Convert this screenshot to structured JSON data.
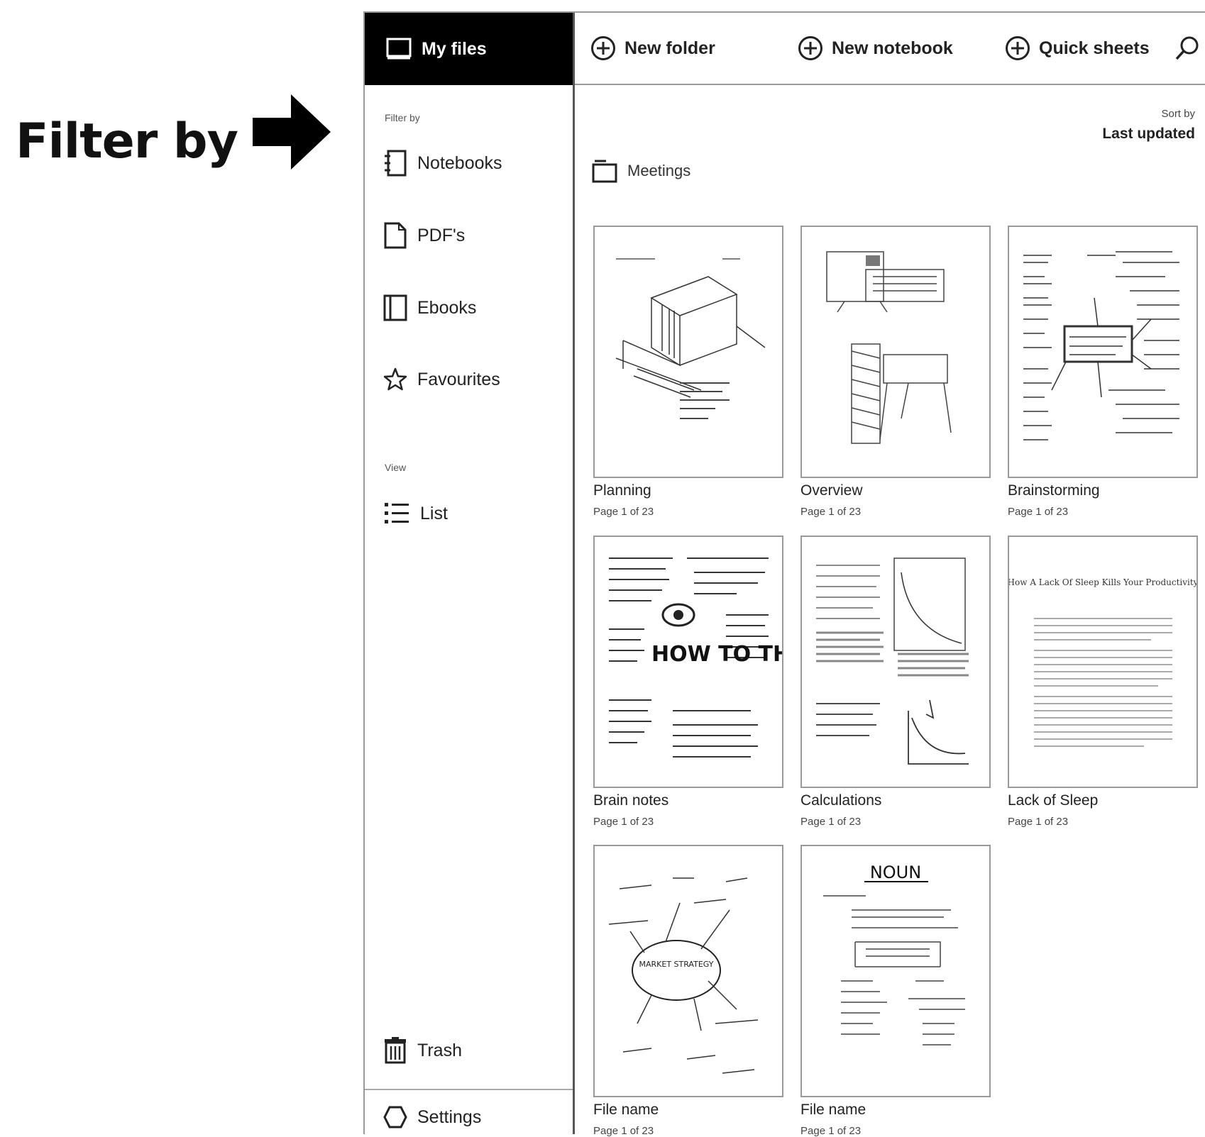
{
  "callout": {
    "text": "Filter by"
  },
  "sidebar": {
    "header_label": "My files",
    "filter_label": "Filter by",
    "filters": [
      {
        "label": "Notebooks",
        "icon": "notebook-icon"
      },
      {
        "label": "PDF's",
        "icon": "pdf-icon"
      },
      {
        "label": "Ebooks",
        "icon": "ebook-icon"
      },
      {
        "label": "Favourites",
        "icon": "star-icon"
      }
    ],
    "view_label": "View",
    "view_option": "List",
    "trash_label": "Trash",
    "settings_label": "Settings"
  },
  "toolbar": {
    "new_folder": "New folder",
    "new_notebook": "New notebook",
    "quick_sheets": "Quick sheets"
  },
  "sort": {
    "label": "Sort by",
    "value": "Last updated"
  },
  "folder": {
    "name": "Meetings"
  },
  "files": [
    {
      "title": "Planning",
      "page": "Page 1 of 23"
    },
    {
      "title": "Overview",
      "page": "Page 1 of 23"
    },
    {
      "title": "Brainstorming",
      "page": "Page 1 of 23"
    },
    {
      "title": "Brain notes",
      "page": "Page 1 of 23"
    },
    {
      "title": "Calculations",
      "page": "Page 1 of 23"
    },
    {
      "title": "Lack of Sleep",
      "page": "Page 1 of 23"
    },
    {
      "title": "File name",
      "page": "Page 1 of 23"
    },
    {
      "title": "File name",
      "page": "Page 1 of 23"
    }
  ],
  "thumb_text": {
    "brain_notes_title": "HOW TO THINK BETTER",
    "lack_of_sleep_title": "How A Lack Of Sleep Kills Your Productivity",
    "noun_title": "NOUN",
    "market_title": "MARKET STRATEGY"
  }
}
